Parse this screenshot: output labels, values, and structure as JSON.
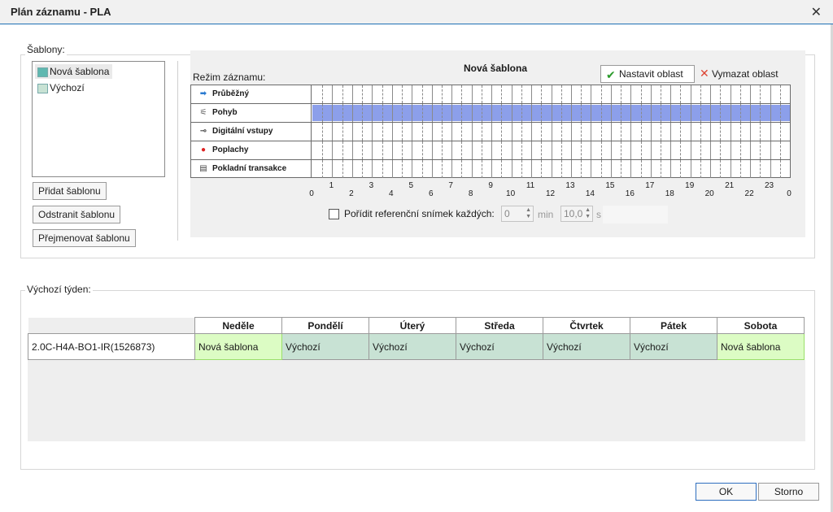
{
  "window": {
    "title": "Plán záznamu - PLA",
    "close_glyph": "✕"
  },
  "templates": {
    "group_label": "Šablony:",
    "items": [
      {
        "label": "Nová šablona",
        "color": "#5fb8b0",
        "selected": true
      },
      {
        "label": "Výchozí",
        "color": "#c8e2d4",
        "selected": false
      }
    ],
    "add_button": "Přidat šablonu",
    "remove_button": "Odstranit šablonu",
    "rename_button": "Přejmenovat šablonu"
  },
  "schedule": {
    "title": "Nová šablona",
    "mode_label": "Režim záznamu:",
    "set_area_button": "Nastavit oblast",
    "clear_area_button": "Vymazat oblast",
    "fill_color": "#8c9fea",
    "rows": [
      {
        "label": "Průběžný",
        "icon": "continuous-icon",
        "filled": false
      },
      {
        "label": "Pohyb",
        "icon": "motion-icon",
        "filled": true
      },
      {
        "label": "Digitální vstupy",
        "icon": "digital-input-icon",
        "filled": false
      },
      {
        "label": "Poplachy",
        "icon": "alarm-icon",
        "filled": false
      },
      {
        "label": "Pokladní transakce",
        "icon": "pos-transaction-icon",
        "filled": false
      }
    ],
    "hour_labels": [
      "0",
      "1",
      "2",
      "3",
      "4",
      "5",
      "6",
      "7",
      "8",
      "9",
      "10",
      "11",
      "12",
      "13",
      "14",
      "15",
      "16",
      "17",
      "18",
      "19",
      "20",
      "21",
      "22",
      "23",
      "0"
    ],
    "reference": {
      "checkbox_label": "Pořídit referenční snímek každých:",
      "checked": false,
      "minutes_value": "0",
      "minutes_unit": "min",
      "seconds_value": "10,0",
      "seconds_unit": "s"
    }
  },
  "week": {
    "group_label": "Výchozí týden:",
    "days": [
      "Neděle",
      "Pondělí",
      "Úterý",
      "Středa",
      "Čtvrtek",
      "Pátek",
      "Sobota"
    ],
    "camera": "2.0C-H4A-BO1-IR(1526873)",
    "assignments": [
      "Nová šablona",
      "Výchozí",
      "Výchozí",
      "Výchozí",
      "Výchozí",
      "Výchozí",
      "Nová šablona"
    ]
  },
  "footer": {
    "ok": "OK",
    "cancel": "Storno"
  }
}
